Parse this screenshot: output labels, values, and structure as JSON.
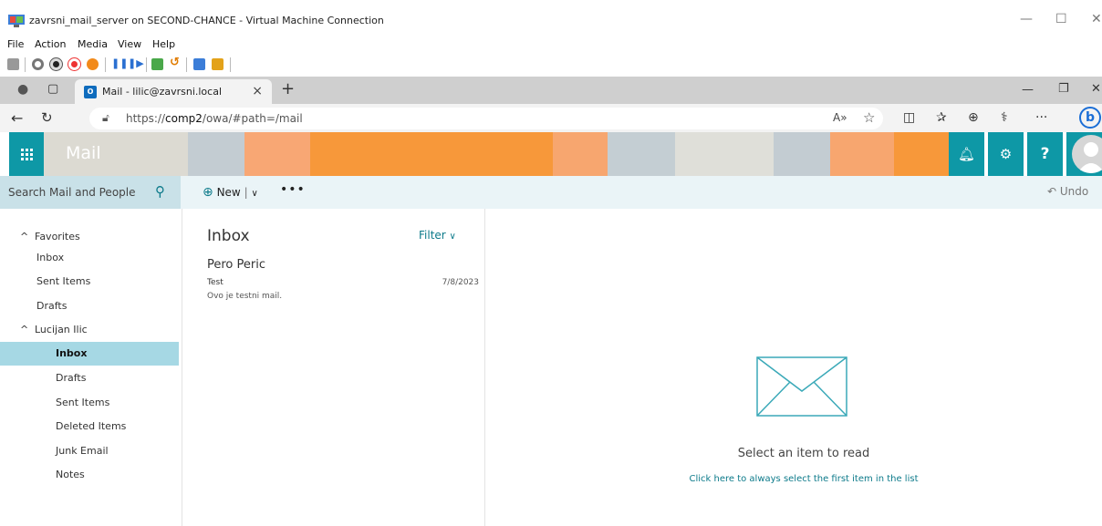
{
  "vm": {
    "title": "zavrsni_mail_server on SECOND-CHANCE - Virtual Machine Connection",
    "menu": [
      "File",
      "Action",
      "Media",
      "View",
      "Help"
    ]
  },
  "browser": {
    "tab_title": "Mail - lilic@zavrsni.local",
    "tab_favicon": "O",
    "new_tab": "+",
    "url_prefix": "https://",
    "url_host": "comp2",
    "url_path": "/owa/#path=/mail"
  },
  "owa": {
    "app_name": "Mail",
    "search_placeholder": "Search Mail and People",
    "new_label": "New",
    "more_label": "•••",
    "undo_label": "Undo",
    "nav": {
      "favorites_header": "Favorites",
      "favorites": [
        "Inbox",
        "Sent Items",
        "Drafts"
      ],
      "account_header": "Lucijan Ilic",
      "folders": [
        "Inbox",
        "Drafts",
        "Sent Items",
        "Deleted Items",
        "Junk Email",
        "Notes"
      ]
    },
    "list": {
      "folder_title": "Inbox",
      "filter_label": "Filter",
      "messages": [
        {
          "sender": "Pero Peric",
          "subject": "Test",
          "date": "7/8/2023",
          "preview": "Ovo je testni mail."
        }
      ]
    },
    "reading": {
      "empty_message": "Select an item to read",
      "select_first_link": "Click here to always select the first item in the list"
    },
    "colors": {
      "accent": "#0e98a6",
      "selected": "#a6d8e4",
      "link": "#0c7a8a"
    }
  }
}
